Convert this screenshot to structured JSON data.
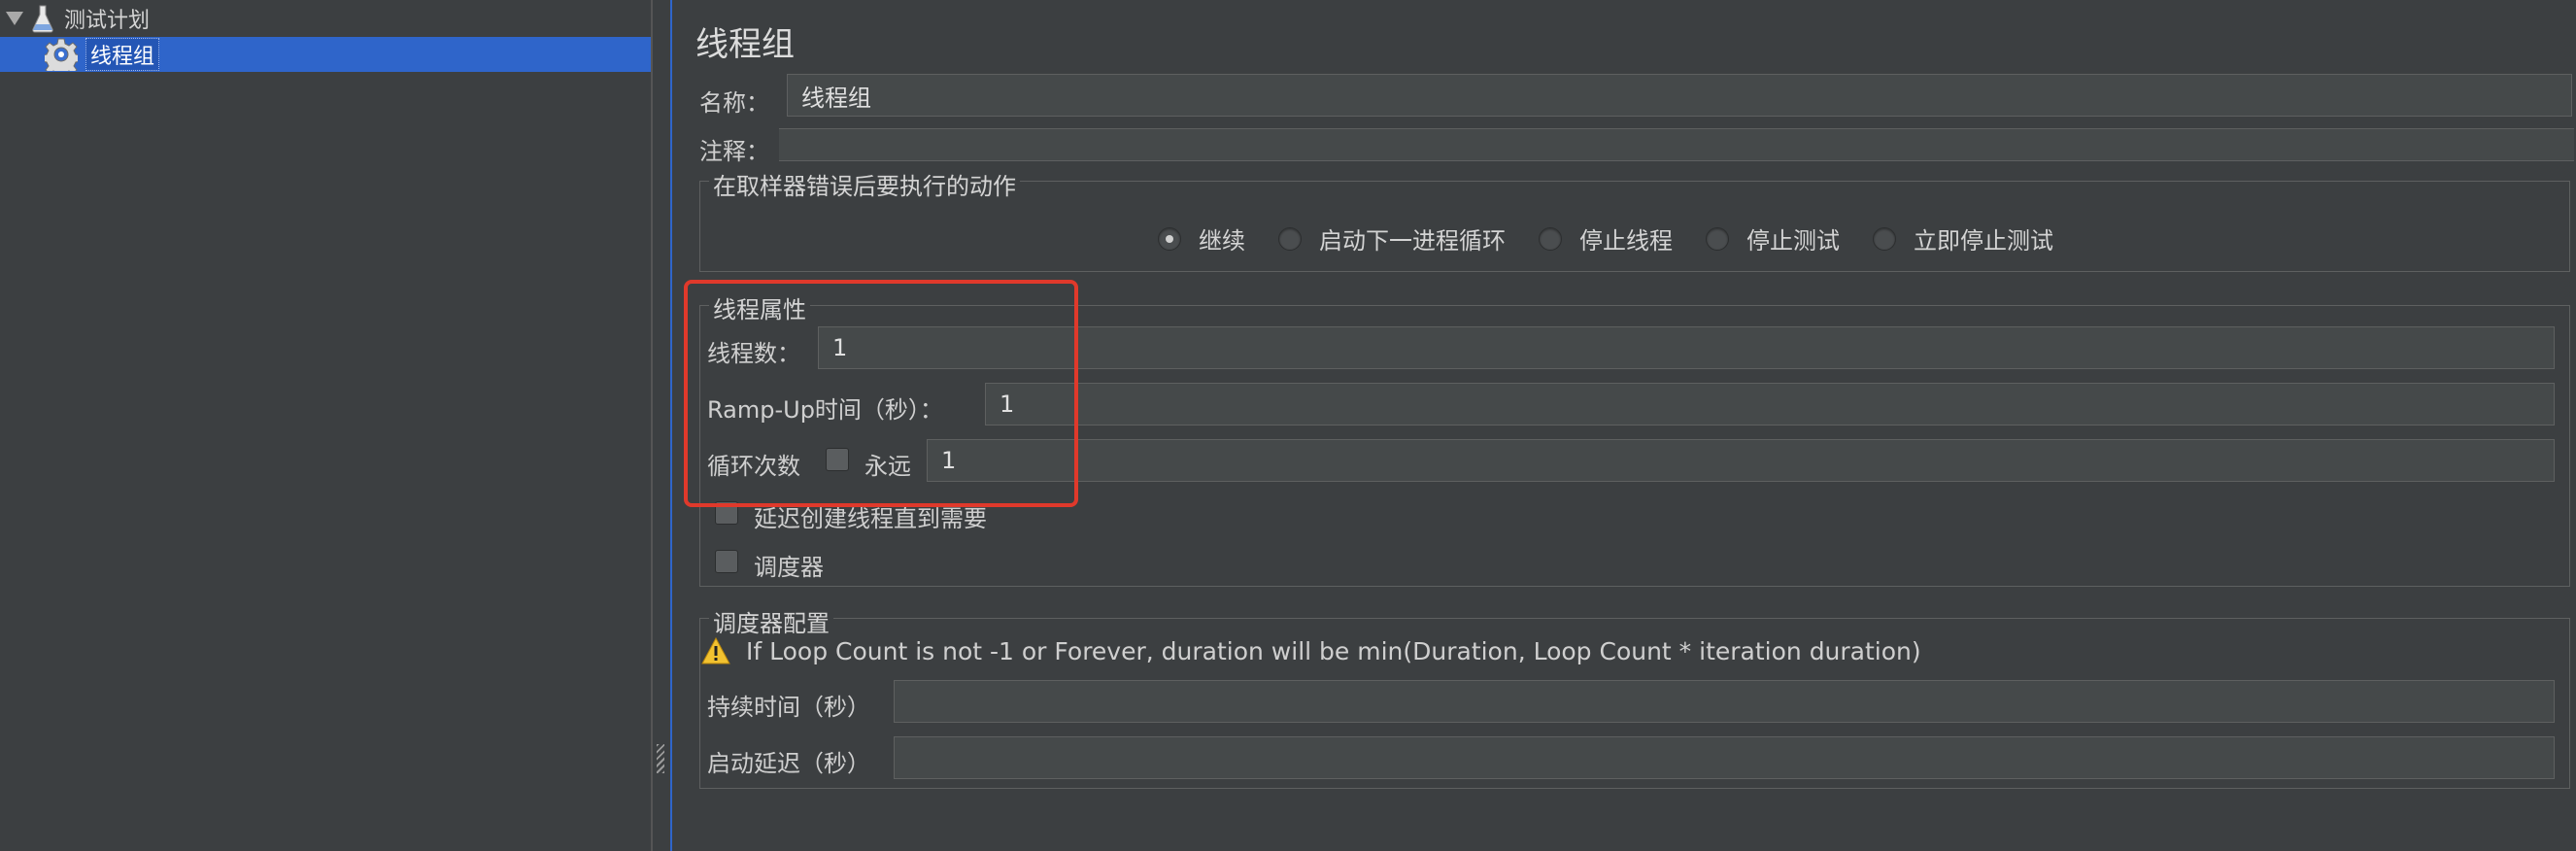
{
  "tree": {
    "root_label": "测试计划",
    "selected_label": "线程组"
  },
  "panel": {
    "title": "线程组",
    "name_label": "名称：",
    "name_value": "线程组",
    "comment_label": "注释：",
    "comment_value": ""
  },
  "error_action": {
    "legend": "在取样器错误后要执行的动作",
    "options": [
      "继续",
      "启动下一进程循环",
      "停止线程",
      "停止测试",
      "立即停止测试"
    ],
    "selected": "继续"
  },
  "thread_props": {
    "legend": "线程属性",
    "threads_label": "线程数：",
    "threads_value": "1",
    "rampup_label": "Ramp-Up时间（秒）：",
    "rampup_value": "1",
    "loop_label": "循环次数",
    "forever_label": "永远",
    "forever_checked": false,
    "loop_value": "1",
    "delay_label": "延迟创建线程直到需要",
    "delay_checked": false,
    "scheduler_label": "调度器",
    "scheduler_checked": false
  },
  "scheduler_config": {
    "legend": "调度器配置",
    "warning": "If Loop Count is not -1 or Forever, duration will be min(Duration, Loop Count * iteration duration)",
    "duration_label": "持续时间（秒）",
    "duration_value": "",
    "delay_label": "启动延迟（秒）",
    "delay_value": ""
  },
  "colors": {
    "background": "#3c3f41",
    "selection": "#2f65ca",
    "highlight_box": "#e0392b",
    "field_bg": "#45494a"
  },
  "icons": {
    "tree_expand": "triangle-down-icon",
    "root": "flask-icon",
    "thread_group": "gear-icon",
    "warning": "warning-icon"
  }
}
